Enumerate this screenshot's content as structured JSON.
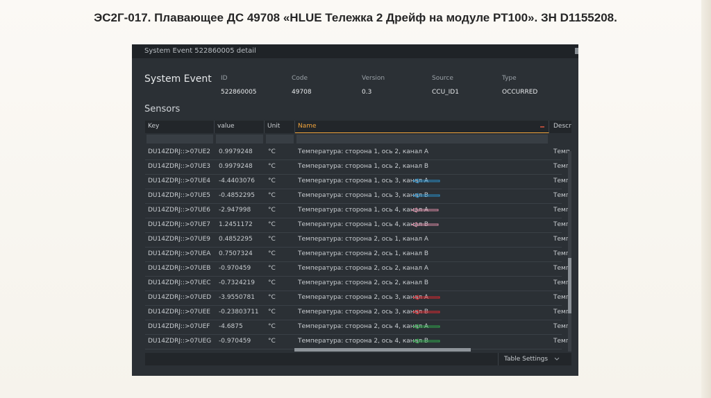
{
  "slide": {
    "title": "ЭС2Г-017. Плавающее ДС 49708 «HLUE Тележка 2 Дрейф на модуле PT100». ЗН D1155208."
  },
  "window": {
    "title": "System Event 522860005 detail"
  },
  "event": {
    "heading": "System Event",
    "fields": [
      {
        "label": "ID",
        "value": "522860005"
      },
      {
        "label": "Code",
        "value": "49708"
      },
      {
        "label": "Version",
        "value": "0.3"
      },
      {
        "label": "Source",
        "value": "CCU_ID1"
      },
      {
        "label": "Type",
        "value": "OCCURRED"
      }
    ]
  },
  "sensors": {
    "heading": "Sensors",
    "columns": {
      "key": "Key",
      "value": "value",
      "unit": "Unit",
      "name": "Name",
      "desc": "Descrip"
    },
    "rows": [
      {
        "key": "DU14ZDRJ::>07UE2",
        "value": "0.9979248",
        "unit": "°C",
        "name": "Температура: сторона 1, ось 2, канал A",
        "desc": "Темп",
        "arrow": null
      },
      {
        "key": "DU14ZDRJ::>07UE3",
        "value": "0.9979248",
        "unit": "°C",
        "name": "Температура: сторона 1, ось 2, канал B",
        "desc": "Темп",
        "arrow": null
      },
      {
        "key": "DU14ZDRJ::>07UE4",
        "value": "-4.4403076",
        "unit": "°C",
        "name": "Температура: сторона 1, ось 3, канал A",
        "desc": "Темп",
        "arrow": "#2a8fc9"
      },
      {
        "key": "DU14ZDRJ::>07UE5",
        "value": "-0.4852295",
        "unit": "°C",
        "name": "Температура: сторона 1, ось 3, канал B",
        "desc": "Темп",
        "arrow": "#2a8fc9"
      },
      {
        "key": "DU14ZDRJ::>07UE6",
        "value": "-2.947998",
        "unit": "°C",
        "name": "Температура: сторона 1, ось 4, канал A",
        "desc": "Темп",
        "arrow": "#d98aa3"
      },
      {
        "key": "DU14ZDRJ::>07UE7",
        "value": "1.2451172",
        "unit": "°C",
        "name": "Температура: сторона 1, ось 4, канал B",
        "desc": "Темп",
        "arrow": "#d98aa3"
      },
      {
        "key": "DU14ZDRJ::>07UE9",
        "value": "0.4852295",
        "unit": "°C",
        "name": "Температура: сторона 2, ось 1, канал A",
        "desc": "Темп",
        "arrow": null
      },
      {
        "key": "DU14ZDRJ::>07UEA",
        "value": "0.7507324",
        "unit": "°C",
        "name": "Температура: сторона 2, ось 1, канал B",
        "desc": "Темп",
        "arrow": null
      },
      {
        "key": "DU14ZDRJ::>07UEB",
        "value": "-0.970459",
        "unit": "°C",
        "name": "Температура: сторона 2, ось 2, канал A",
        "desc": "Темп",
        "arrow": null
      },
      {
        "key": "DU14ZDRJ::>07UEC",
        "value": "-0.7324219",
        "unit": "°C",
        "name": "Температура: сторона 2, ось 2, канал B",
        "desc": "Темп",
        "arrow": null
      },
      {
        "key": "DU14ZDRJ::>07UED",
        "value": "-3.9550781",
        "unit": "°C",
        "name": "Температура: сторона 2, ось 3, канал A",
        "desc": "Темп",
        "arrow": "#d9272e"
      },
      {
        "key": "DU14ZDRJ::>07UEE",
        "value": "-0.23803711",
        "unit": "°C",
        "name": "Температура: сторона 2, ось 3, канал B",
        "desc": "Темп",
        "arrow": "#d9272e"
      },
      {
        "key": "DU14ZDRJ::>07UEF",
        "value": "-4.6875",
        "unit": "°C",
        "name": "Температура: сторона 2, ось 4, канал A",
        "desc": "Темп",
        "arrow": "#2fa84a"
      },
      {
        "key": "DU14ZDRJ::>07UEG",
        "value": "-0.970459",
        "unit": "°C",
        "name": "Температура: сторона 2, ось 4, канал B",
        "desc": "Темп",
        "arrow": "#2fa84a"
      }
    ]
  },
  "footer": {
    "table_settings_label": "Table Settings",
    "dropdown_icon": "chevron-down-icon"
  },
  "colors": {
    "panel_bg": "#2b3035",
    "header_bg": "#22262a",
    "accent_sort_column": "#f3a53b"
  }
}
